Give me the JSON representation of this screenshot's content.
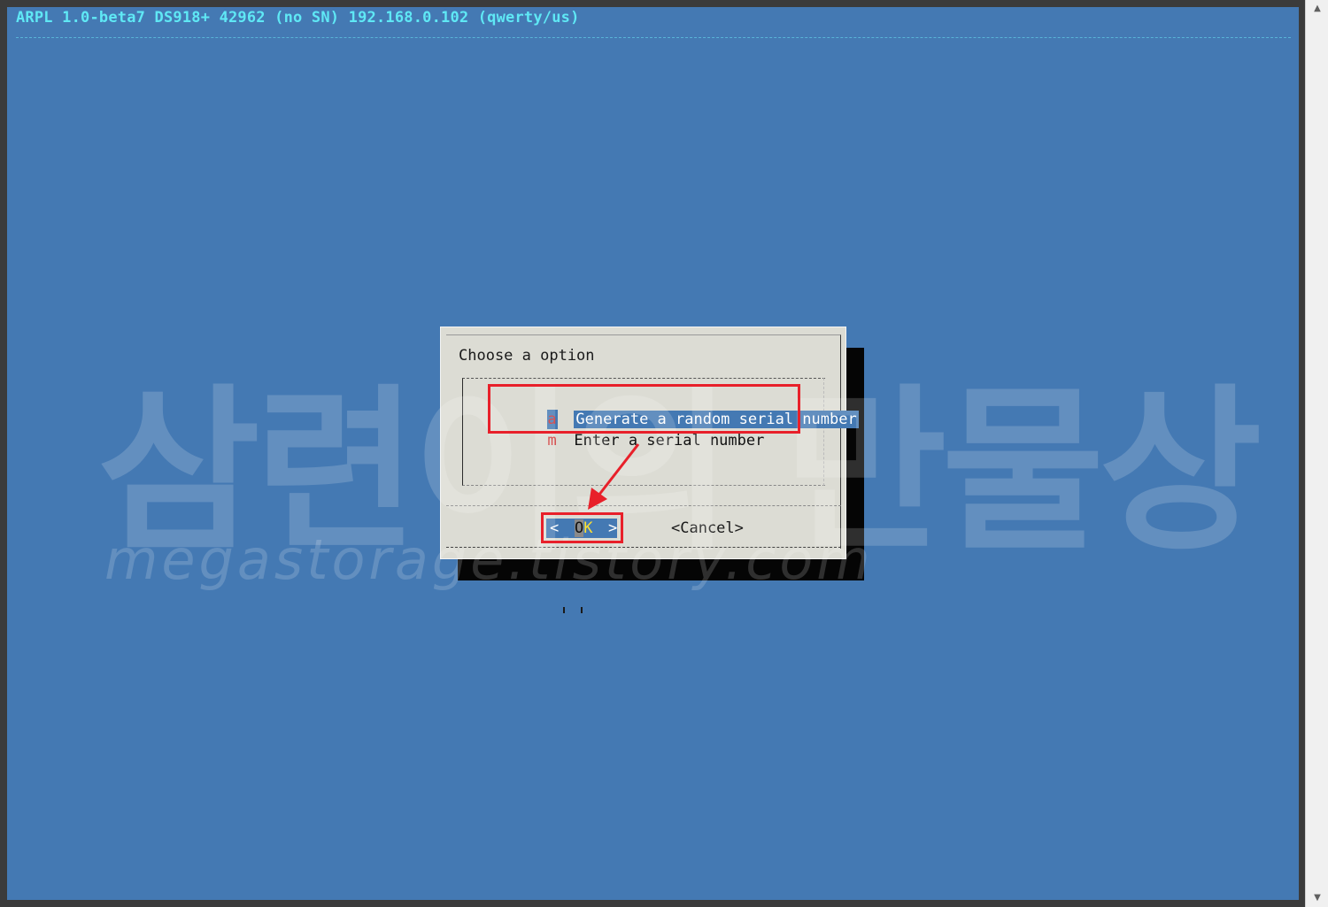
{
  "terminal": {
    "backtitle": "ARPL 1.0-beta7 DS918+ 42962 (no SN) 192.168.0.102 (qwerty/us)"
  },
  "dialog": {
    "title": "Choose a option",
    "menu_items": [
      {
        "tag": "a",
        "label": "Generate a random serial number",
        "selected": true
      },
      {
        "tag": "m",
        "label": "Enter a serial number",
        "selected": false
      }
    ],
    "buttons": {
      "ok_left": "<",
      "ok_o": "O",
      "ok_k": "K",
      "ok_right": ">",
      "cancel": "<Cancel>"
    }
  },
  "watermark": {
    "korean": "삼련이의 만물상",
    "url": "megastorage.tistory.com"
  },
  "colors": {
    "terminal_bg": "#4479b3",
    "backtitle": "#5fe8f5",
    "dialog_bg": "#dcdcd4",
    "highlight": "#e8202a",
    "tag": "#d03030",
    "ok_hotkey": "#ffe030"
  },
  "icons": {
    "scroll_up": "triangle-up-icon",
    "scroll_down": "triangle-down-icon",
    "annotation_arrow": "red-arrow-icon"
  }
}
